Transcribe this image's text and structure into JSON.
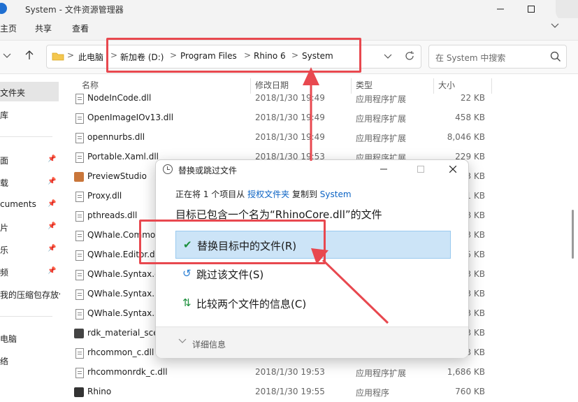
{
  "window": {
    "title": "System - 文件资源管理器"
  },
  "ribbon": {
    "tabs": [
      "主页",
      "共享",
      "查看"
    ]
  },
  "address_bar": {
    "breadcrumbs": [
      "此电脑",
      "新加卷 (D:)",
      "Program Files",
      "Rhino 6",
      "System"
    ],
    "separator": ">"
  },
  "search": {
    "placeholder": "在 System 中搜索"
  },
  "sidebar": {
    "items": [
      {
        "label": "文件夹",
        "pinned": false
      },
      {
        "label": "库",
        "pinned": false
      },
      {
        "label": "面",
        "pinned": true
      },
      {
        "label": "载",
        "pinned": true
      },
      {
        "label": "cuments",
        "pinned": true
      },
      {
        "label": "片",
        "pinned": true
      },
      {
        "label": "乐",
        "pinned": true
      },
      {
        "label": "频",
        "pinned": true
      },
      {
        "label": "我的压缩包存放位",
        "pinned": false
      },
      {
        "label": "电脑",
        "pinned": false
      },
      {
        "label": "络",
        "pinned": false
      }
    ]
  },
  "columns": {
    "name": "名称",
    "date": "修改日期",
    "type": "类型",
    "size": "大小"
  },
  "files": [
    {
      "name": "NodeInCode.dll",
      "date": "2018/1/30 19:49",
      "type": "应用程序扩展",
      "size": "22 KB"
    },
    {
      "name": "OpenImageIOv13.dll",
      "date": "2018/1/30 19:49",
      "type": "应用程序扩展",
      "size": "458 KB"
    },
    {
      "name": "opennurbs.dll",
      "date": "2018/1/30 19:49",
      "type": "应用程序扩展",
      "size": "8,046 KB"
    },
    {
      "name": "Portable.Xaml.dll",
      "date": "2018/1/30 19:53",
      "type": "应用程序扩展",
      "size": "229 KB"
    },
    {
      "name": "PreviewStudio",
      "date": "",
      "type": "",
      "size": "3 KB"
    },
    {
      "name": "Proxy.dll",
      "date": "",
      "type": "",
      "size": "1 KB"
    },
    {
      "name": "pthreads.dll",
      "date": "",
      "type": "",
      "size": "8 KB"
    },
    {
      "name": "QWhale.Common",
      "date": "",
      "type": "",
      "size": "3 KB"
    },
    {
      "name": "QWhale.Editor.dll",
      "date": "",
      "type": "",
      "size": "5 KB"
    },
    {
      "name": "QWhale.Syntax.dll",
      "date": "",
      "type": "",
      "size": "3 KB"
    },
    {
      "name": "QWhale.Syntax.Pa",
      "date": "",
      "type": "",
      "size": "3 KB"
    },
    {
      "name": "QWhale.Syntax.Sc",
      "date": "",
      "type": "",
      "size": "3 KB"
    },
    {
      "name": "rdk_material_scen",
      "date": "",
      "type": "",
      "size": "3 KB"
    },
    {
      "name": "rhcommon_c.dll",
      "date": "",
      "type": "",
      "size": "3 KB"
    },
    {
      "name": "rhcommonrdk_c.dll",
      "date": "2018/1/30 19:53",
      "type": "应用程序扩展",
      "size": "1,686 KB"
    },
    {
      "name": "Rhino",
      "date": "2018/1/30 19:55",
      "type": "应用程序",
      "size": "760 KB"
    }
  ],
  "dialog": {
    "title": "替换或跳过文件",
    "info_prefix": "正在将 1 个项目从",
    "info_source": "授权文件夹",
    "info_mid": "复制到",
    "info_dest": "System",
    "heading": "目标已包含一个名为“RhinoCore.dll”的文件",
    "options": [
      {
        "label": "替换目标中的文件(R)",
        "icon": "check-icon",
        "active": true
      },
      {
        "label": "跳过该文件(S)",
        "icon": "skip-icon",
        "active": false
      },
      {
        "label": "比较两个文件的信息(C)",
        "icon": "compare-icon",
        "active": false
      }
    ],
    "details_label": "详细信息"
  },
  "colors": {
    "accent": "#0b63c4",
    "highlight": "#cce4f7",
    "annotation": "#e8484f"
  }
}
